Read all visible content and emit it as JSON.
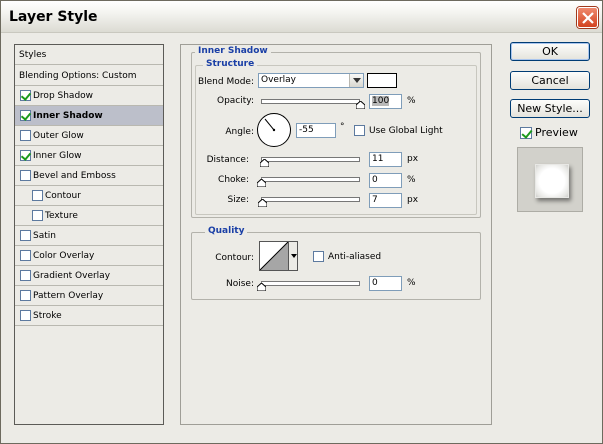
{
  "window": {
    "title": "Layer Style"
  },
  "styles_list": {
    "header": "Styles",
    "blending_options": "Blending Options: Custom",
    "items": [
      {
        "label": "Drop Shadow",
        "checked": true,
        "selected": false,
        "indent": false
      },
      {
        "label": "Inner Shadow",
        "checked": true,
        "selected": true,
        "indent": false
      },
      {
        "label": "Outer Glow",
        "checked": false,
        "selected": false,
        "indent": false
      },
      {
        "label": "Inner Glow",
        "checked": true,
        "selected": false,
        "indent": false
      },
      {
        "label": "Bevel and Emboss",
        "checked": false,
        "selected": false,
        "indent": false
      },
      {
        "label": "Contour",
        "checked": false,
        "selected": false,
        "indent": true
      },
      {
        "label": "Texture",
        "checked": false,
        "selected": false,
        "indent": true
      },
      {
        "label": "Satin",
        "checked": false,
        "selected": false,
        "indent": false
      },
      {
        "label": "Color Overlay",
        "checked": false,
        "selected": false,
        "indent": false
      },
      {
        "label": "Gradient Overlay",
        "checked": false,
        "selected": false,
        "indent": false
      },
      {
        "label": "Pattern Overlay",
        "checked": false,
        "selected": false,
        "indent": false
      },
      {
        "label": "Stroke",
        "checked": false,
        "selected": false,
        "indent": false
      }
    ]
  },
  "panel": {
    "title": "Inner Shadow",
    "structure": {
      "title": "Structure",
      "blend_mode_label": "Blend Mode:",
      "blend_mode_value": "Overlay",
      "blend_color": "#ffffff",
      "opacity_label": "Opacity:",
      "opacity_value": "100",
      "opacity_unit": "%",
      "opacity_level": 1.0,
      "angle_label": "Angle:",
      "angle_value": "-55",
      "angle_unit": "°",
      "use_global_light_label": "Use Global Light",
      "use_global_light_checked": false,
      "distance_label": "Distance:",
      "distance_value": "11",
      "distance_unit": "px",
      "distance_level": 0.04,
      "choke_label": "Choke:",
      "choke_value": "0",
      "choke_unit": "%",
      "choke_level": 0.0,
      "size_label": "Size:",
      "size_value": "7",
      "size_unit": "px",
      "size_level": 0.02
    },
    "quality": {
      "title": "Quality",
      "contour_label": "Contour:",
      "anti_aliased_label": "Anti-aliased",
      "anti_aliased_checked": false,
      "noise_label": "Noise:",
      "noise_value": "0",
      "noise_unit": "%",
      "noise_level": 0.0
    }
  },
  "buttons": {
    "ok": "OK",
    "cancel": "Cancel",
    "new_style": "New Style...",
    "preview_label": "Preview",
    "preview_checked": true
  }
}
